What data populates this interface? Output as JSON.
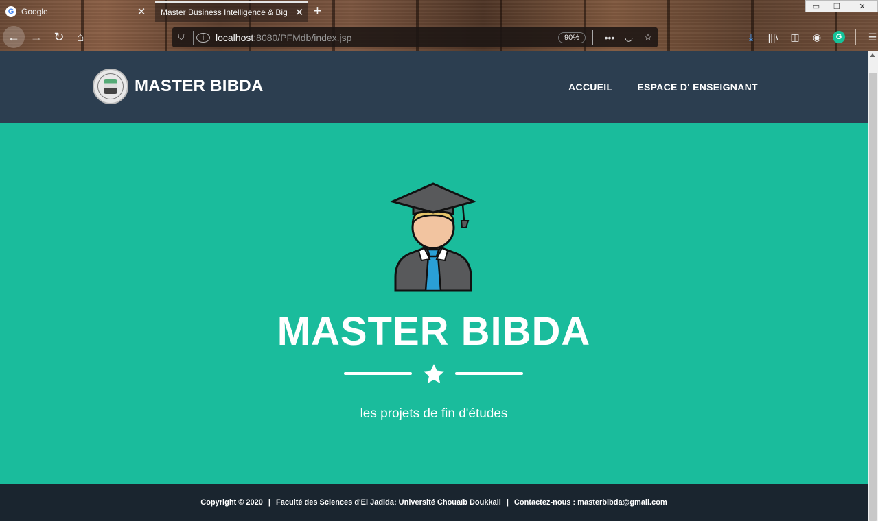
{
  "browser": {
    "tabs": [
      {
        "favicon": "G",
        "title": "Google",
        "active": false
      },
      {
        "title": "Master Business Intelligence & Big",
        "active": true
      }
    ],
    "new_tab": "+",
    "url_host": "localhost",
    "url_rest": ":8080/PFMdb/index.jsp",
    "zoom": "90%",
    "icons": {
      "back": "back-arrow-icon",
      "forward": "forward-arrow-icon",
      "reload": "reload-icon",
      "home": "home-icon",
      "more": "more-icon",
      "pocket": "pocket-icon",
      "bookmark": "star-icon",
      "download": "download-icon",
      "library": "library-icon",
      "sidebar": "sidebar-icon",
      "account": "account-icon",
      "grammarly": "G",
      "menu": "hamburger-icon"
    },
    "accent": "#1abc9c"
  },
  "site": {
    "brand": "MASTER BIBDA",
    "nav": [
      "ACCUEIL",
      "ESPACE D' ENSEIGNANT"
    ],
    "hero_title": "MASTER BIBDA",
    "tagline": "les projets de fin d'études",
    "footer": {
      "copyright": "Copyright © 2020",
      "faculty": "Faculté des Sciences d'El Jadida: Université Chouaïb Doukkali",
      "contact": "Contactez-nous : masterbibda@gmail.com"
    },
    "colors": {
      "nav_bg": "#2c3e50",
      "hero_bg": "#1abc9c",
      "footer_bg": "#1a252f"
    }
  }
}
